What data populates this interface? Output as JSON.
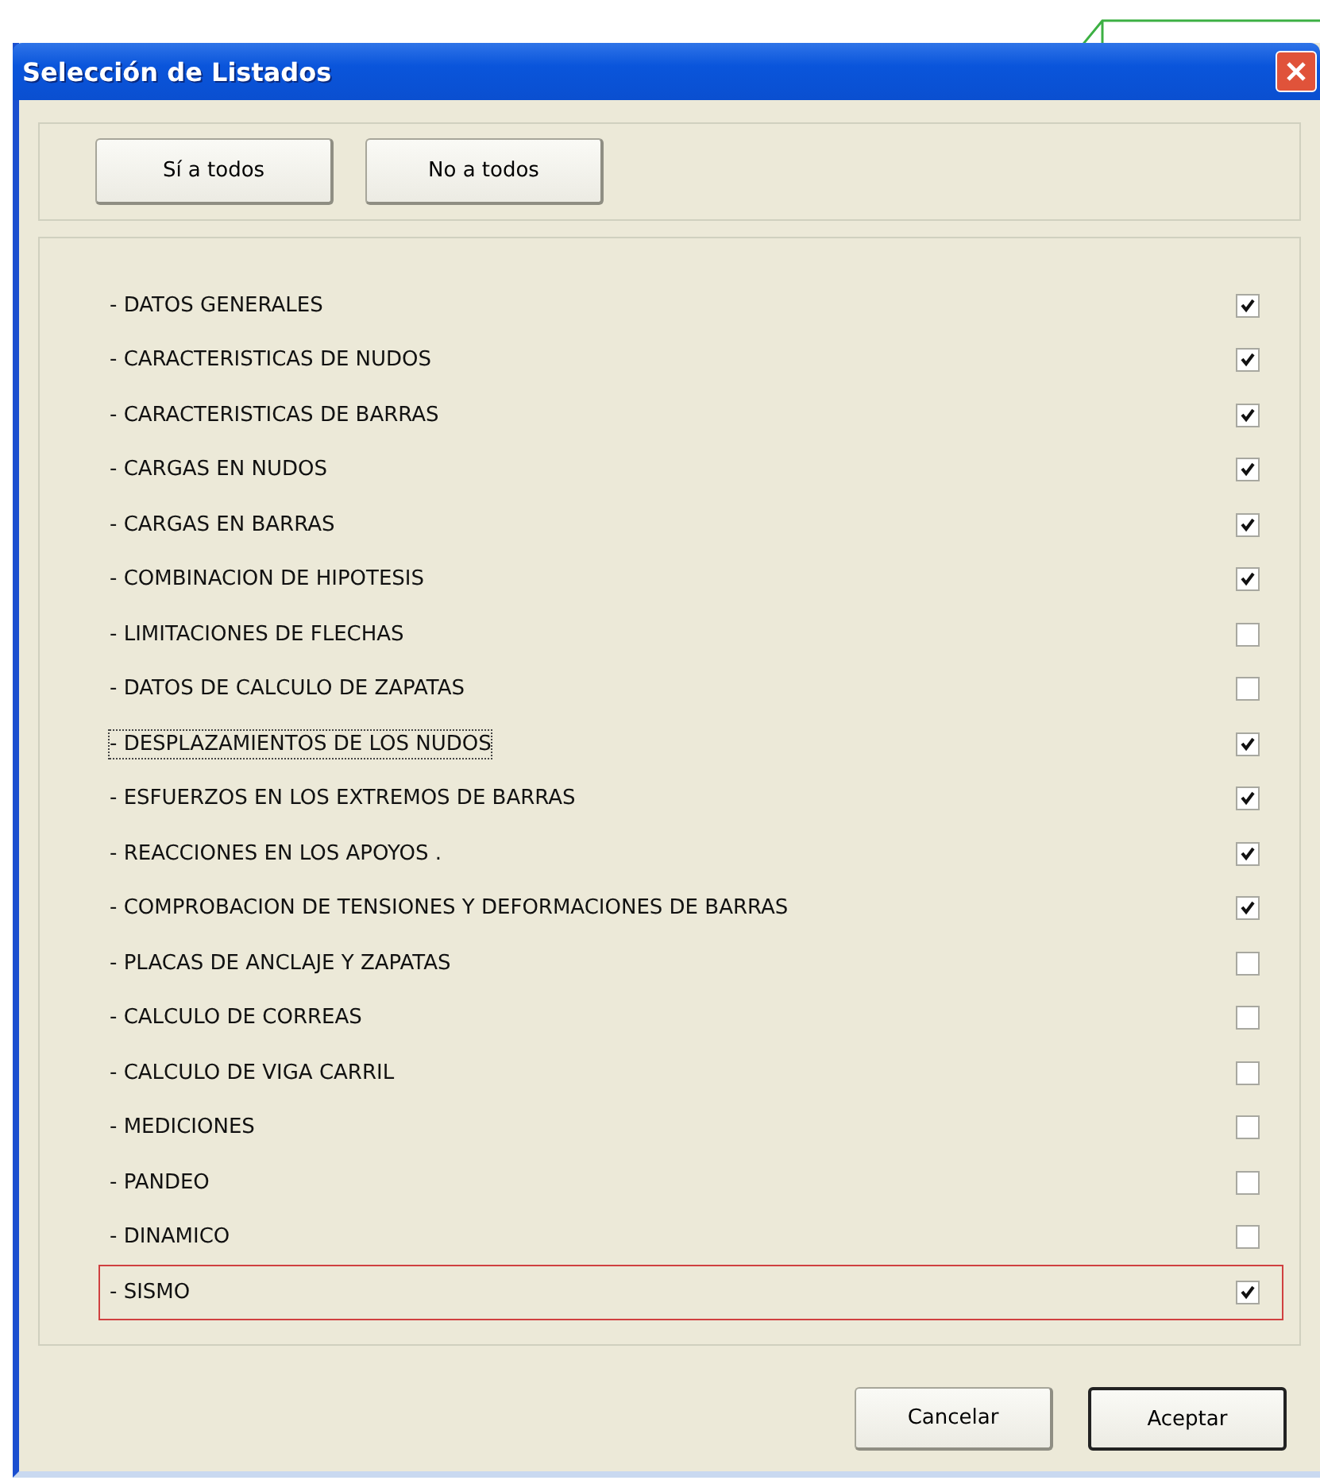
{
  "window": {
    "title": "Selección de Listados"
  },
  "top_buttons": [
    "Sí a todos",
    "No a todos"
  ],
  "items": [
    {
      "label": "- DATOS GENERALES",
      "checked": true,
      "focused": false,
      "highlighted": false
    },
    {
      "label": "- CARACTERISTICAS DE NUDOS",
      "checked": true,
      "focused": false,
      "highlighted": false
    },
    {
      "label": "- CARACTERISTICAS DE BARRAS",
      "checked": true,
      "focused": false,
      "highlighted": false
    },
    {
      "label": "- CARGAS EN NUDOS",
      "checked": true,
      "focused": false,
      "highlighted": false
    },
    {
      "label": "- CARGAS EN BARRAS",
      "checked": true,
      "focused": false,
      "highlighted": false
    },
    {
      "label": "- COMBINACION DE HIPOTESIS",
      "checked": true,
      "focused": false,
      "highlighted": false
    },
    {
      "label": "- LIMITACIONES DE FLECHAS",
      "checked": false,
      "focused": false,
      "highlighted": false
    },
    {
      "label": "- DATOS DE CALCULO DE ZAPATAS",
      "checked": false,
      "focused": false,
      "highlighted": false
    },
    {
      "label": "- DESPLAZAMIENTOS DE LOS NUDOS",
      "checked": true,
      "focused": true,
      "highlighted": false
    },
    {
      "label": "- ESFUERZOS EN LOS EXTREMOS DE BARRAS",
      "checked": true,
      "focused": false,
      "highlighted": false
    },
    {
      "label": "- REACCIONES EN LOS APOYOS .",
      "checked": true,
      "focused": false,
      "highlighted": false
    },
    {
      "label": "- COMPROBACION DE TENSIONES Y DEFORMACIONES DE BARRAS",
      "checked": true,
      "focused": false,
      "highlighted": false
    },
    {
      "label": "- PLACAS DE ANCLAJE Y ZAPATAS",
      "checked": false,
      "focused": false,
      "highlighted": false
    },
    {
      "label": "- CALCULO DE CORREAS",
      "checked": false,
      "focused": false,
      "highlighted": false
    },
    {
      "label": "- CALCULO DE VIGA CARRIL",
      "checked": false,
      "focused": false,
      "highlighted": false
    },
    {
      "label": "- MEDICIONES",
      "checked": false,
      "focused": false,
      "highlighted": false
    },
    {
      "label": "- PANDEO",
      "checked": false,
      "focused": false,
      "highlighted": false
    },
    {
      "label": "- DINAMICO",
      "checked": false,
      "focused": false,
      "highlighted": false
    },
    {
      "label": "- SISMO",
      "checked": true,
      "focused": false,
      "highlighted": true
    }
  ],
  "bottom_buttons": [
    {
      "label": "Cancelar",
      "default": false
    },
    {
      "label": "Aceptar",
      "default": true
    }
  ]
}
